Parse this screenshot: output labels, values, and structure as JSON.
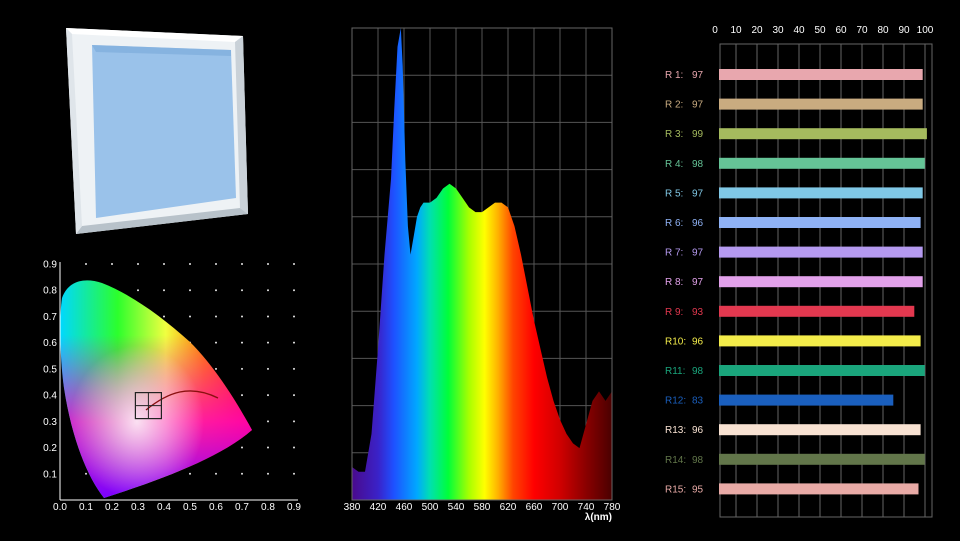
{
  "chart_data": [
    {
      "type": "scatter",
      "x_ticks": [
        "0.0",
        "0.1",
        "0.2",
        "0.3",
        "0.4",
        "0.5",
        "0.6",
        "0.7",
        "0.8",
        "0.9"
      ],
      "y_ticks": [
        "0.1",
        "0.2",
        "0.3",
        "0.4",
        "0.5",
        "0.6",
        "0.7",
        "0.8",
        "0.9"
      ],
      "xlim": [
        0,
        0.9
      ],
      "ylim": [
        0,
        0.9
      ],
      "grid": "dots",
      "marker_point": {
        "x": 0.34,
        "y": 0.36
      }
    },
    {
      "type": "area",
      "x_ticks": [
        "380",
        "420",
        "460",
        "500",
        "540",
        "580",
        "620",
        "660",
        "700",
        "740",
        "780"
      ],
      "xlabel": "λ(nm)",
      "xlim": [
        380,
        780
      ],
      "ylim": [
        0,
        1
      ],
      "grid": true,
      "x": [
        380,
        390,
        400,
        410,
        420,
        430,
        440,
        445,
        450,
        455,
        458,
        462,
        466,
        470,
        475,
        480,
        485,
        490,
        495,
        500,
        510,
        520,
        530,
        540,
        550,
        560,
        570,
        580,
        590,
        600,
        610,
        620,
        630,
        640,
        650,
        660,
        670,
        680,
        690,
        700,
        710,
        720,
        730,
        740,
        750,
        760,
        770,
        780
      ],
      "values": [
        0.07,
        0.06,
        0.06,
        0.14,
        0.32,
        0.52,
        0.68,
        0.83,
        0.96,
        1.0,
        0.92,
        0.72,
        0.58,
        0.52,
        0.56,
        0.6,
        0.62,
        0.63,
        0.63,
        0.63,
        0.64,
        0.66,
        0.67,
        0.66,
        0.64,
        0.62,
        0.61,
        0.61,
        0.62,
        0.63,
        0.63,
        0.62,
        0.58,
        0.52,
        0.45,
        0.38,
        0.32,
        0.26,
        0.21,
        0.17,
        0.14,
        0.12,
        0.11,
        0.16,
        0.21,
        0.23,
        0.21,
        0.23
      ]
    },
    {
      "type": "bar",
      "orientation": "horizontal",
      "axis_ticks": [
        "0",
        "10",
        "20",
        "30",
        "40",
        "50",
        "60",
        "70",
        "80",
        "90",
        "100"
      ],
      "xlim": [
        0,
        100
      ],
      "grid": true,
      "categories": [
        "R 1:",
        "R 2:",
        "R 3:",
        "R 4:",
        "R 5:",
        "R 6:",
        "R 7:",
        "R 8:",
        "R 9:",
        "R10:",
        "R11:",
        "R12:",
        "R13:",
        "R14:",
        "R15:"
      ],
      "value_labels": [
        "97",
        "97",
        "99",
        "98",
        "97",
        "96",
        "97",
        "97",
        "93",
        "96",
        "98",
        "83",
        "96",
        "98",
        "95"
      ],
      "values": [
        97,
        97,
        99,
        98,
        97,
        96,
        97,
        97,
        93,
        96,
        98,
        83,
        96,
        98,
        95
      ],
      "colors": [
        "#e8a7ae",
        "#c9ab80",
        "#a5bb5e",
        "#65c497",
        "#80c8e6",
        "#8fb2f5",
        "#b59af0",
        "#e2a1ea",
        "#e2384f",
        "#f3ec4a",
        "#1aa57c",
        "#1a5fbe",
        "#f8e2d2",
        "#62764a",
        "#e8aaa6"
      ]
    }
  ]
}
